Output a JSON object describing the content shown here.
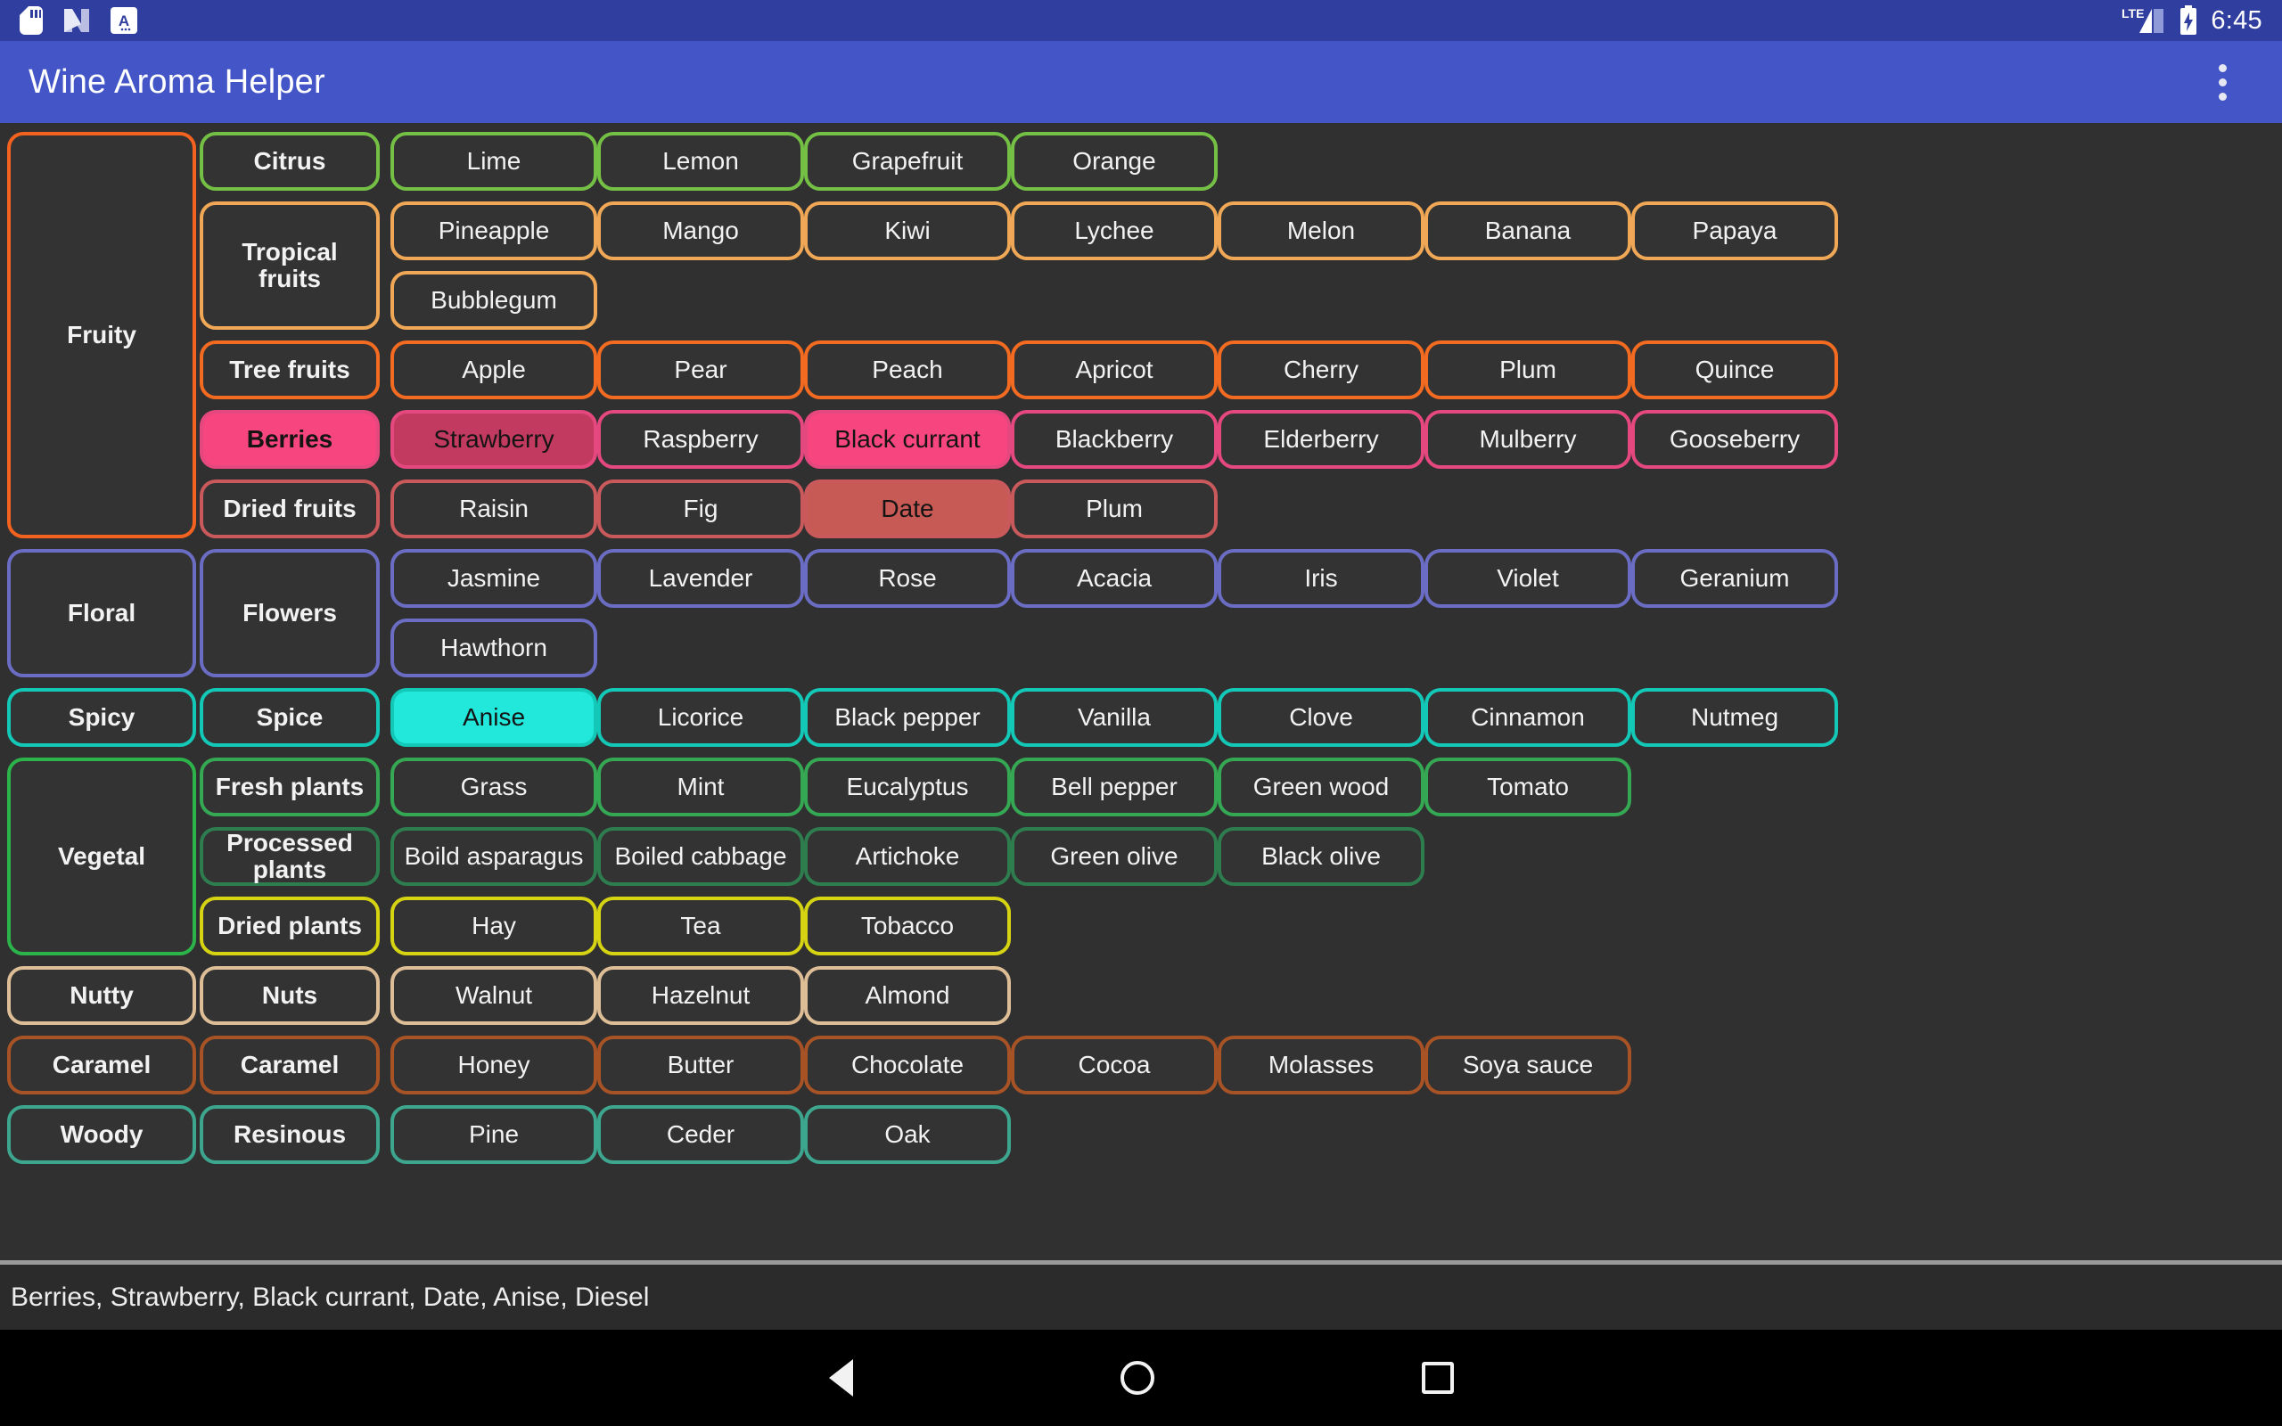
{
  "status_bar": {
    "icons": [
      "sd-card-icon",
      "nougat-icon",
      "font-a-icon"
    ],
    "network": "LTE",
    "battery": "charging",
    "time": "6:45"
  },
  "app_bar": {
    "title": "Wine Aroma Helper",
    "overflow_label": "overflow-menu"
  },
  "colors": {
    "app_bar": "#4355C7",
    "status_bar": "#303F9F",
    "background": "#303030",
    "chip_bg": "#333333",
    "fruity": "#F4621F",
    "citrus": "#74C045",
    "tropical": "#F0A857",
    "tree_fruits": "#F26B21",
    "berries": "#E5487F",
    "berries_selected": "#F7457F",
    "berries_dim": "#C23A5F",
    "dried_fruits": "#C9595B",
    "dried_fruits_selected": "#C75A55",
    "floral": "#6B6DC4",
    "spicy": "#14C8B8",
    "spicy_selected": "#22E8DC",
    "fresh_plants": "#35A853",
    "processed_plants": "#2E7D4F",
    "dried_plants": "#D6D313",
    "vegetal": "#2CB34A",
    "nutty": "#DDBE96",
    "caramel": "#A85325",
    "woody": "#3DA68E"
  },
  "groups": [
    {
      "category": "Fruity",
      "category_color": "#F4621F",
      "rows": [
        {
          "sub": "Citrus",
          "color": "#74C045",
          "items": [
            "Lime",
            "Lemon",
            "Grapefruit",
            "Orange"
          ]
        },
        {
          "sub": "Tropical fruits",
          "color": "#F0A857",
          "sub_span": 2,
          "items": [
            "Pineapple",
            "Mango",
            "Kiwi",
            "Lychee",
            "Melon",
            "Banana",
            "Papaya"
          ],
          "items2": [
            "Bubblegum"
          ]
        },
        {
          "sub": "Tree fruits",
          "color": "#F26B21",
          "items": [
            "Apple",
            "Pear",
            "Peach",
            "Apricot",
            "Cherry",
            "Plum",
            "Quince"
          ]
        },
        {
          "sub": "Berries",
          "color": "#E5487F",
          "sub_state": "selected",
          "items": [
            "Strawberry",
            "Raspberry",
            "Black currant",
            "Blackberry",
            "Elderberry",
            "Mulberry",
            "Gooseberry"
          ],
          "item_states": [
            "dim",
            "off",
            "selected",
            "off",
            "off",
            "off",
            "off"
          ]
        },
        {
          "sub": "Dried fruits",
          "color": "#C9595B",
          "items": [
            "Raisin",
            "Fig",
            "Date",
            "Plum"
          ],
          "item_states": [
            "off",
            "off",
            "dim",
            "off"
          ]
        }
      ]
    },
    {
      "category": "Floral",
      "category_color": "#6B6DC4",
      "rows": [
        {
          "sub": "Flowers",
          "color": "#6B6DC4",
          "sub_span": 2,
          "items": [
            "Jasmine",
            "Lavender",
            "Rose",
            "Acacia",
            "Iris",
            "Violet",
            "Geranium"
          ],
          "items2": [
            "Hawthorn"
          ]
        }
      ]
    },
    {
      "category": "Spicy",
      "category_color": "#14C8B8",
      "rows": [
        {
          "sub": "Spice",
          "color": "#14C8B8",
          "items": [
            "Anise",
            "Licorice",
            "Black pepper",
            "Vanilla",
            "Clove",
            "Cinnamon",
            "Nutmeg"
          ],
          "item_states": [
            "selected",
            "off",
            "off",
            "off",
            "off",
            "off",
            "off"
          ]
        }
      ]
    },
    {
      "category": "Vegetal",
      "category_color": "#2CB34A",
      "rows": [
        {
          "sub": "Fresh plants",
          "color": "#35A853",
          "items": [
            "Grass",
            "Mint",
            "Eucalyptus",
            "Bell pepper",
            "Green wood",
            "Tomato"
          ]
        },
        {
          "sub": "Processed plants",
          "color": "#2E7D4F",
          "items": [
            "Boild asparagus",
            "Boiled cabbage",
            "Artichoke",
            "Green olive",
            "Black olive"
          ]
        },
        {
          "sub": "Dried plants",
          "color": "#D6D313",
          "items": [
            "Hay",
            "Tea",
            "Tobacco"
          ]
        }
      ]
    },
    {
      "category": "Nutty",
      "category_color": "#DDBE96",
      "rows": [
        {
          "sub": "Nuts",
          "color": "#DDBE96",
          "items": [
            "Walnut",
            "Hazelnut",
            "Almond"
          ]
        }
      ]
    },
    {
      "category": "Caramel",
      "category_color": "#A85325",
      "rows": [
        {
          "sub": "Caramel",
          "color": "#A85325",
          "items": [
            "Honey",
            "Butter",
            "Chocolate",
            "Cocoa",
            "Molasses",
            "Soya sauce"
          ]
        }
      ]
    },
    {
      "category": "Woody",
      "category_color": "#3DA68E",
      "rows": [
        {
          "sub": "Resinous",
          "color": "#3DA68E",
          "items": [
            "Pine",
            "Ceder",
            "Oak"
          ]
        }
      ]
    }
  ],
  "selection_bar": {
    "text": "Berries, Strawberry, Black currant, Date, Anise, Diesel"
  },
  "nav_bar": {
    "back": "back-button",
    "home": "home-button",
    "recents": "recents-button"
  }
}
